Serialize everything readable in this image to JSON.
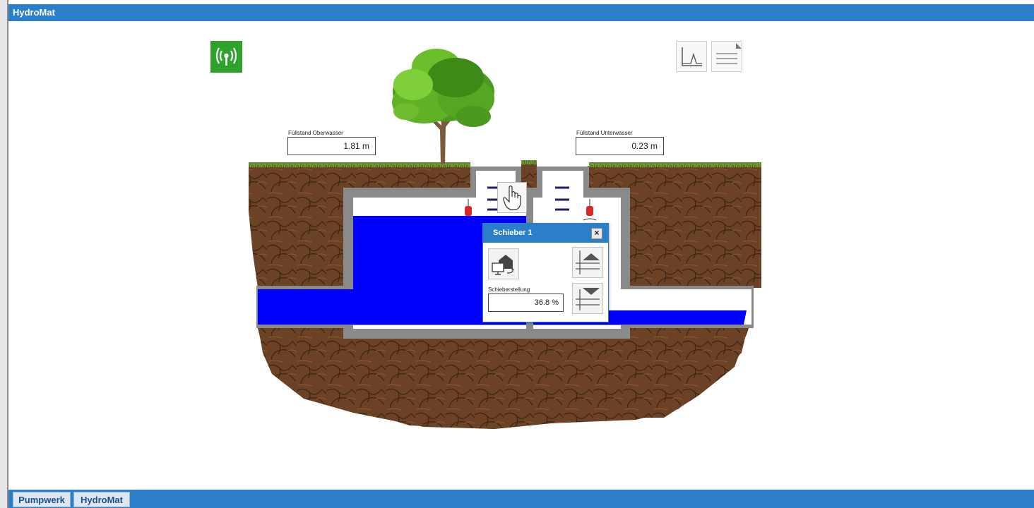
{
  "window": {
    "title": "HydroMat"
  },
  "toolbar": {
    "status_icon": "signal-icon",
    "chart_icon": "chart-icon",
    "report_icon": "report-icon"
  },
  "levels": {
    "upstream": {
      "label": "Füllstand Oberwasser",
      "value": "1.81 m"
    },
    "downstream": {
      "label": "Füllstand Unterwasser",
      "value": "0.23 m"
    }
  },
  "manual_control": {
    "icon": "hand-icon"
  },
  "gate_dialog": {
    "title": "Schieber 1",
    "close_label": "×",
    "mode_icon": "remote-control-icon",
    "open_icon": "gate-open-icon",
    "close_icon": "gate-close-icon",
    "position_label": "Schieberstellung",
    "position_value": "36.8 %"
  },
  "tabs": [
    {
      "label": "Pumpwerk"
    },
    {
      "label": "HydroMat"
    }
  ],
  "colors": {
    "titlebar": "#2b7fc8",
    "water": "#0000ff",
    "status_ok": "#2fa12d",
    "soil": "#6b4226"
  }
}
